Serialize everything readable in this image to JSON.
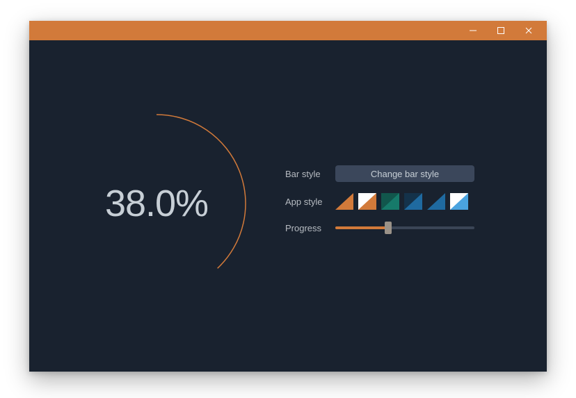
{
  "colors": {
    "accent": "#d27a3a",
    "bg": "#19222f",
    "panel": "#3b475b",
    "text": "#c7cfd6",
    "label": "#b6bbc1",
    "track": "#3a4556",
    "thumb": "#9a9288",
    "white": "#ffffff"
  },
  "progress": {
    "value": 38.0,
    "display": "38.0%"
  },
  "controls": {
    "barstyle_label": "Bar style",
    "barstyle_button": "Change bar style",
    "appstyle_label": "App style",
    "progress_label": "Progress"
  },
  "appstyle_swatches": [
    {
      "name": "orange-solid",
      "bg": "#19222f",
      "tri": "#d27a3a"
    },
    {
      "name": "orange-white",
      "bg": "#ffffff",
      "tri": "#d27a3a"
    },
    {
      "name": "teal-solid",
      "bg": "#11564c",
      "tri": "#167a6a"
    },
    {
      "name": "blue-dark",
      "bg": "#14324a",
      "tri": "#1f6aa0"
    },
    {
      "name": "blue-solid",
      "bg": "#19222f",
      "tri": "#1f6aa0"
    },
    {
      "name": "skyblue-white",
      "bg": "#ffffff",
      "tri": "#4aa3df"
    }
  ]
}
